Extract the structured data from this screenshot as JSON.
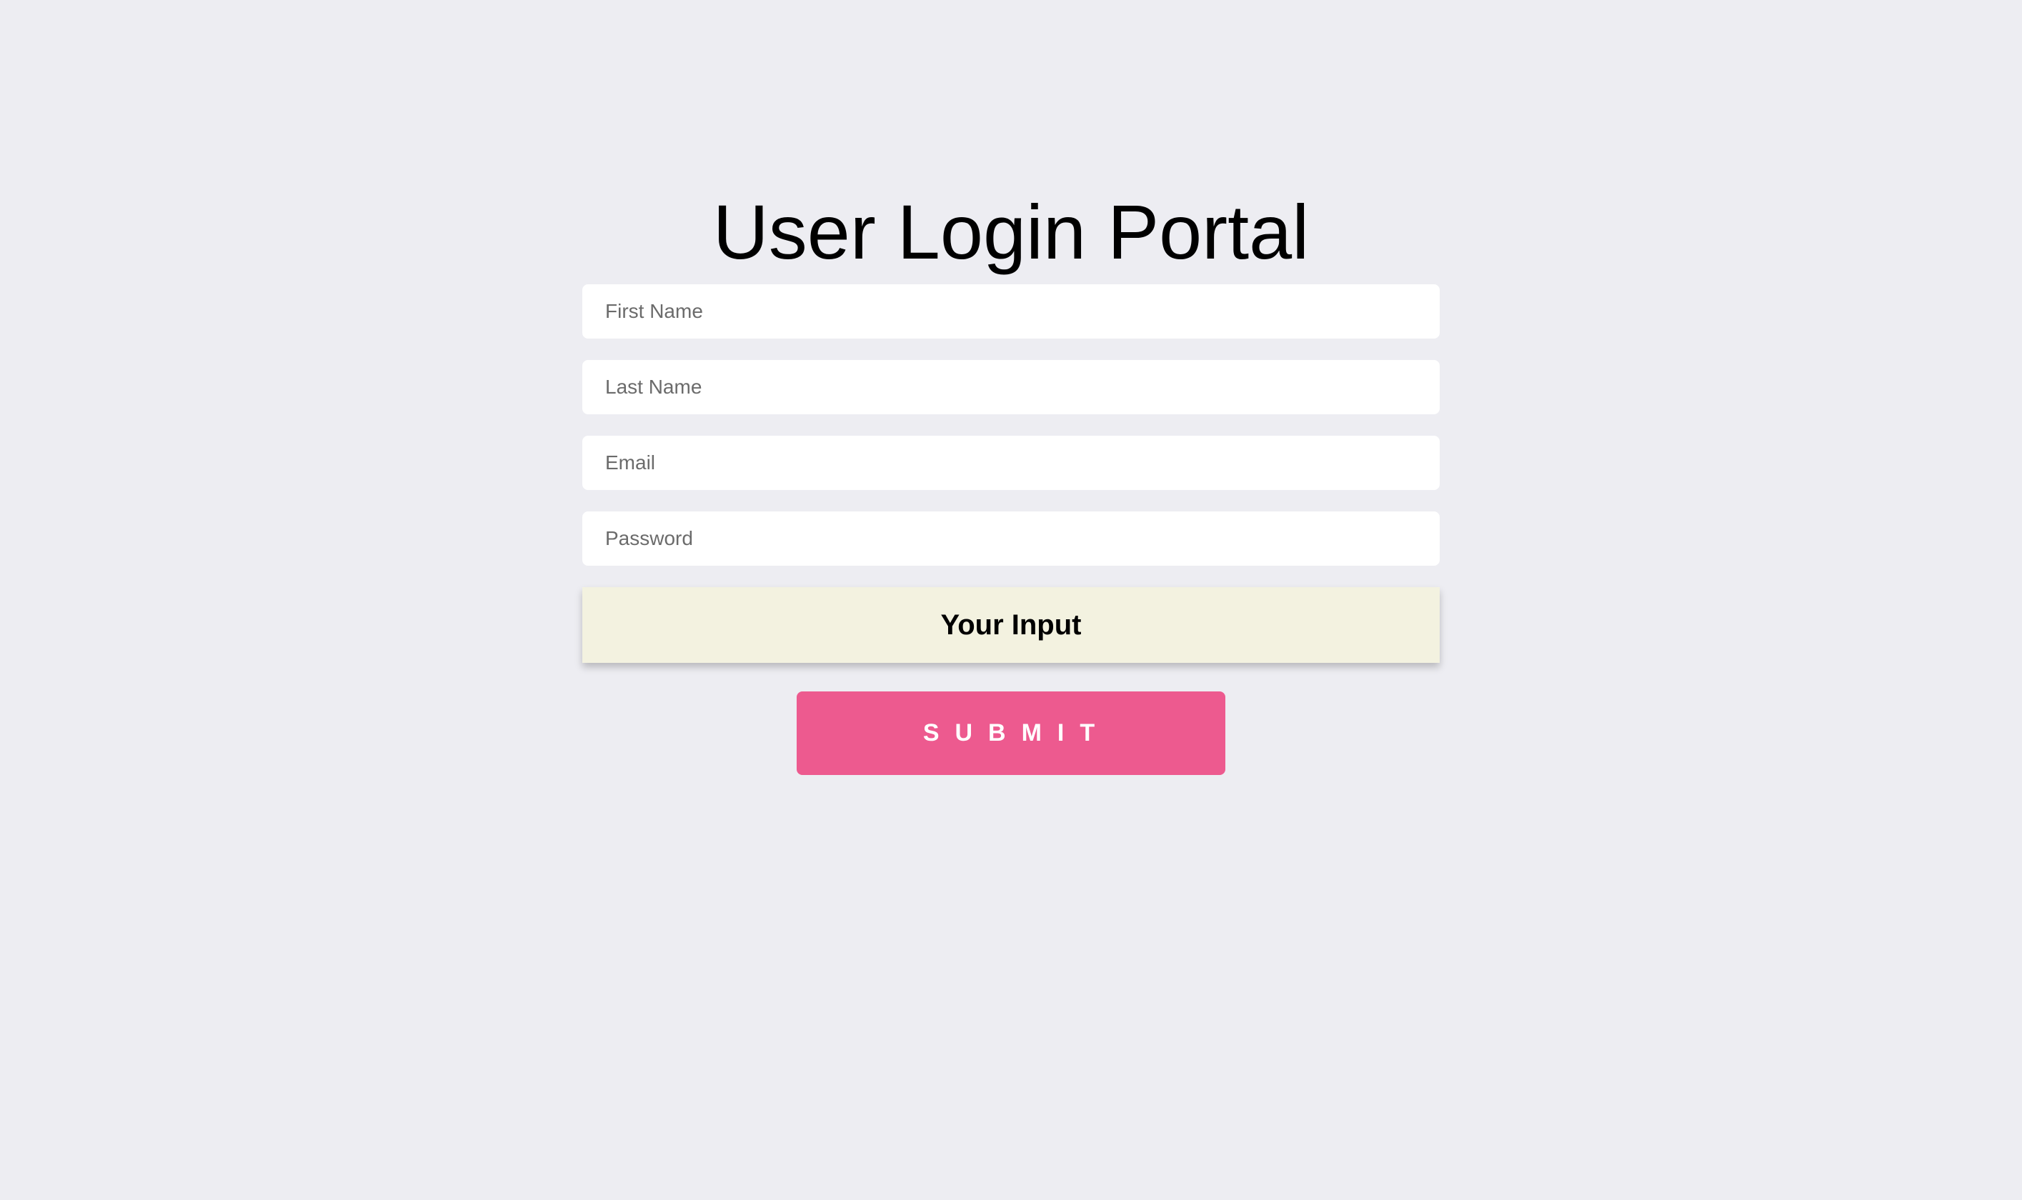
{
  "page": {
    "title": "User Login Portal",
    "background_color": "#ededf2"
  },
  "form": {
    "fields": [
      {
        "name": "first_name",
        "placeholder": "First Name",
        "value": ""
      },
      {
        "name": "last_name",
        "placeholder": "Last Name",
        "value": ""
      },
      {
        "name": "email",
        "placeholder": "Email",
        "value": ""
      },
      {
        "name": "password",
        "placeholder": "Password",
        "value": ""
      }
    ],
    "your_input_label": "Your Input",
    "your_input_color": "#f3f2e0",
    "submit_label": "SUBMIT",
    "submit_color": "#ed5a8f"
  }
}
